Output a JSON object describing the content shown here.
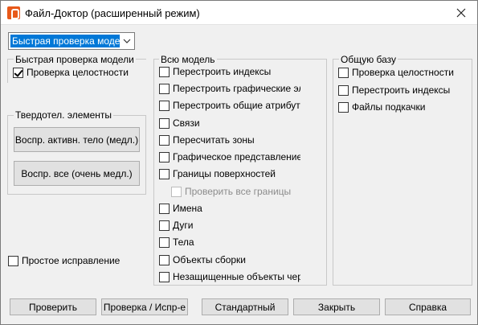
{
  "window": {
    "title": "Файл-Доктор (расширенный режим)",
    "icon": "app-logo-icon",
    "close_icon": "close-icon"
  },
  "mode_select": {
    "value": "Быстрая проверка моде"
  },
  "quick_check": {
    "title": "Быстрая проверка модели",
    "items": [
      {
        "label": "Проверка целостности",
        "checked": true
      }
    ]
  },
  "solids": {
    "title": "Твердотел. элементы",
    "buttons": [
      {
        "label": "Воспр. активн. тело (медл.)"
      },
      {
        "label": "Воспр. все (очень медл.)"
      }
    ]
  },
  "simple_fix": {
    "label": "Простое исправление",
    "checked": false
  },
  "whole_model": {
    "title": "Всю модель",
    "items": [
      {
        "label": "Перестроить индексы",
        "checked": false
      },
      {
        "label": "Перестроить графические эл",
        "checked": false
      },
      {
        "label": "Перестроить общие атрибуты",
        "checked": false
      },
      {
        "label": "Связи",
        "checked": false
      },
      {
        "label": "Пересчитать зоны",
        "checked": false
      },
      {
        "label": "Графическое представление",
        "checked": false
      },
      {
        "label": "Границы поверхностей",
        "checked": false
      },
      {
        "label": "Проверить все границы",
        "checked": false,
        "disabled": true
      },
      {
        "label": "Имена",
        "checked": false
      },
      {
        "label": "Дуги",
        "checked": false
      },
      {
        "label": "Тела",
        "checked": false
      },
      {
        "label": "Объекты сборки",
        "checked": false
      },
      {
        "label": "Незащищенные объекты чер",
        "checked": false
      }
    ]
  },
  "common_base": {
    "title": "Общую базу",
    "items": [
      {
        "label": "Проверка целостности",
        "checked": false
      },
      {
        "label": "Перестроить индексы",
        "checked": false
      },
      {
        "label": "Файлы подкачки",
        "checked": false
      }
    ]
  },
  "footer": {
    "buttons": [
      {
        "label": "Проверить"
      },
      {
        "label": "Проверка / Испр-е"
      },
      {
        "label": "Стандартный"
      },
      {
        "label": "Закрыть"
      },
      {
        "label": "Справка"
      }
    ]
  }
}
